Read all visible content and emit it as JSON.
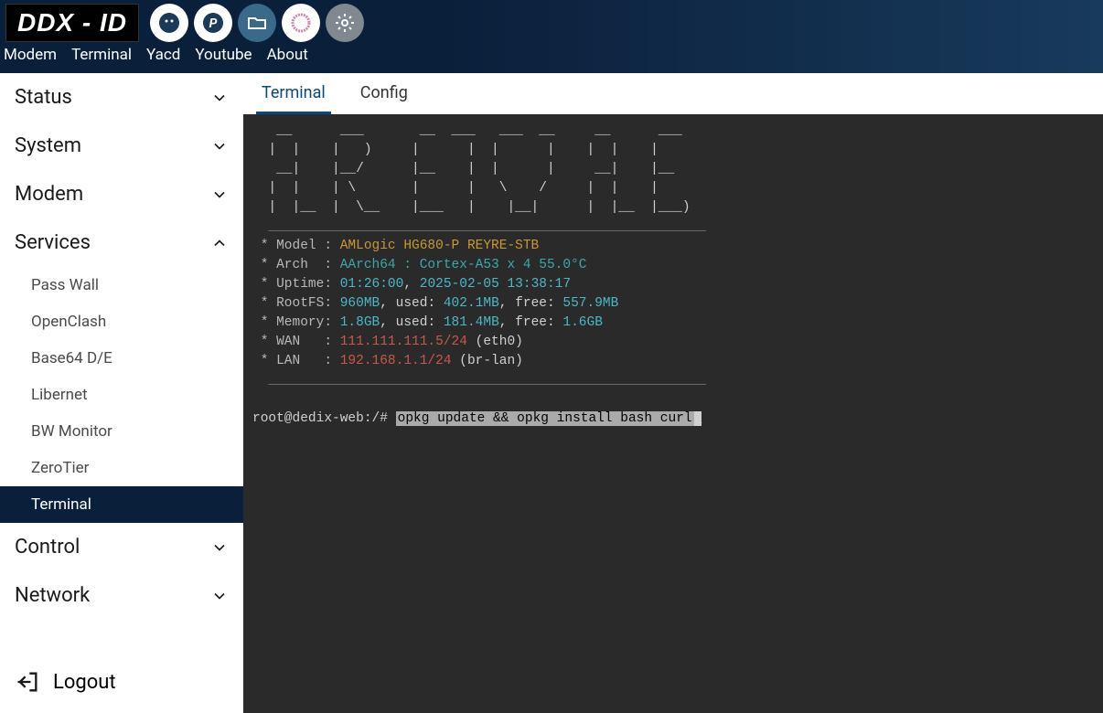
{
  "header": {
    "logo": "DDX - ID",
    "nav": [
      "Modem",
      "Terminal",
      "Yacd",
      "Youtube",
      "About"
    ]
  },
  "sidebar": {
    "sections": [
      {
        "label": "Status",
        "expanded": false
      },
      {
        "label": "System",
        "expanded": false
      },
      {
        "label": "Modem",
        "expanded": false
      },
      {
        "label": "Services",
        "expanded": true,
        "items": [
          "Pass Wall",
          "OpenClash",
          "Base64 D/E",
          "Libernet",
          "BW Monitor",
          "ZeroTier",
          "Terminal"
        ],
        "active": "Terminal"
      },
      {
        "label": "Control",
        "expanded": false
      },
      {
        "label": "Network",
        "expanded": false
      }
    ],
    "logout": "Logout"
  },
  "tabs": {
    "items": [
      "Terminal",
      "Config"
    ],
    "active": "Terminal"
  },
  "terminal": {
    "ascii": [
      "   __      ___       __  ___   ___  __     __      ___",
      "  |  |    |   )     |      |  |      |    |  |    |",
      "   __|    |__/      |__    |  |      |     __|    |__",
      "  |  |    | \\       |      |   \\    /     |  |    |",
      "  |  |__  |  \\__    |___   |    |__|      |  |__  |___)",
      "  _______________________________________________________"
    ],
    "info": {
      "model_label": " * Model : ",
      "model_val": "AMLogic HG680-P REYRE-STB",
      "arch_label": " * Arch  : ",
      "arch_val": "AArch64 : Cortex-A53 x 4 55.0°C",
      "uptime_label": " * Uptime: ",
      "uptime_val": "01:26:00",
      "uptime_sep": ", ",
      "uptime_date": "2025-02-05 13:38:17",
      "rootfs_label": " * RootFS: ",
      "rootfs_total": "960MB",
      "rootfs_used_lbl": ", used: ",
      "rootfs_used": "402.1MB",
      "rootfs_free_lbl": ", free: ",
      "rootfs_free": "557.9MB",
      "mem_label": " * Memory: ",
      "mem_total": "1.8GB",
      "mem_used_lbl": ", used: ",
      "mem_used": "181.4MB",
      "mem_free_lbl": ", free: ",
      "mem_free": "1.6GB",
      "wan_label": " * WAN   : ",
      "wan_ip": "111.111.111.5/24",
      "wan_if": " (eth0)",
      "lan_label": " * LAN   : ",
      "lan_ip": "192.168.1.1/24",
      "lan_if": " (br-lan)"
    },
    "sep": "  _______________________________________________________",
    "prompt": "root@dedix-web:/# ",
    "command": "opkg update && opkg install bash curl"
  }
}
